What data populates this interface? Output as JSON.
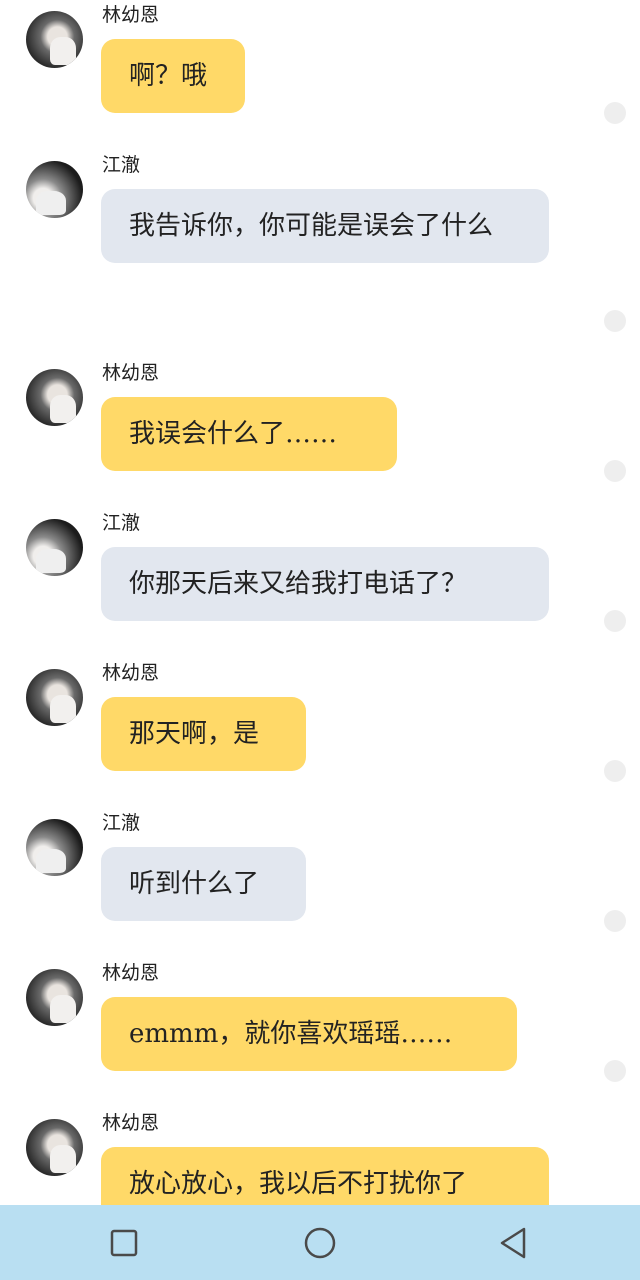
{
  "messages": [
    {
      "sender": "林幼恩",
      "text": "啊？哦",
      "side": "yellow"
    },
    {
      "sender": "江澈",
      "text": "我告诉你，你可能是误会了什么",
      "side": "gray"
    },
    {
      "sender": "林幼恩",
      "text": "我误会什么了……",
      "side": "yellow"
    },
    {
      "sender": "江澈",
      "text": "你那天后来又给我打电话了？",
      "side": "gray"
    },
    {
      "sender": "林幼恩",
      "text": "那天啊，是",
      "side": "yellow"
    },
    {
      "sender": "江澈",
      "text": "听到什么了",
      "side": "gray"
    },
    {
      "sender": "林幼恩",
      "text": "emmm，就你喜欢瑶瑶……",
      "side": "yellow"
    },
    {
      "sender": "林幼恩",
      "text": "放心放心，我以后不打扰你了",
      "side": "yellow"
    }
  ],
  "colors": {
    "bubble_self": "#ffd968",
    "bubble_other": "#e2e7ef",
    "navbar": "#b9dff2"
  },
  "navbar": {
    "icons": [
      "recent-apps-icon",
      "home-icon",
      "back-icon"
    ]
  }
}
